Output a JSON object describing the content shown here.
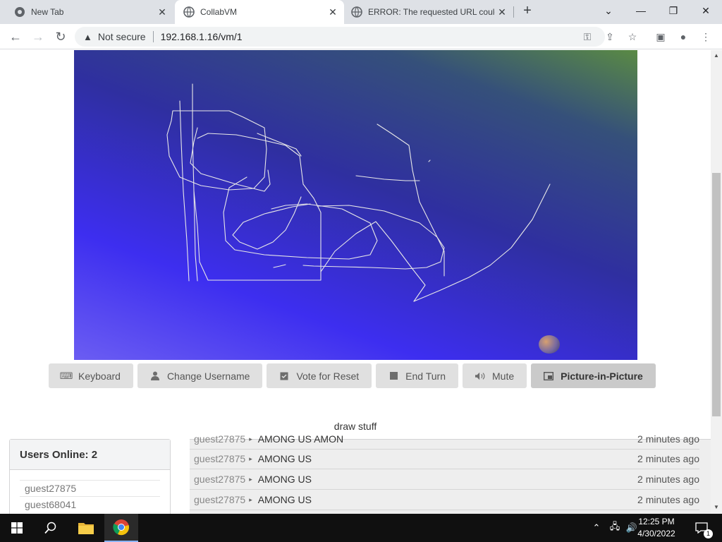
{
  "browser": {
    "tabs": [
      {
        "title": "New Tab",
        "icon": "chrome-icon",
        "active": false
      },
      {
        "title": "CollabVM",
        "icon": "globe-icon",
        "active": true
      },
      {
        "title": "ERROR: The requested URL could",
        "icon": "globe-icon",
        "active": false
      }
    ],
    "security_label": "Not secure",
    "url": "192.168.1.16/vm/1"
  },
  "vm": {
    "buttons": [
      {
        "label": "Keyboard",
        "icon": "keyboard-icon"
      },
      {
        "label": "Change Username",
        "icon": "user-icon"
      },
      {
        "label": "Vote for Reset",
        "icon": "ballot-icon"
      },
      {
        "label": "End Turn",
        "icon": "stop-icon"
      },
      {
        "label": "Mute",
        "icon": "volume-icon"
      },
      {
        "label": "Picture-in-Picture",
        "icon": "pip-icon"
      }
    ],
    "motd": "draw stuff"
  },
  "users": {
    "title": "Users Online: 2",
    "list": [
      "guest27875",
      "guest68041"
    ]
  },
  "chat": {
    "messages": [
      {
        "user": "guest27875",
        "text": "AMONG US AMON",
        "time": "2 minutes ago"
      },
      {
        "user": "guest27875",
        "text": "AMONG US",
        "time": "2 minutes ago"
      },
      {
        "user": "guest27875",
        "text": "AMONG US",
        "time": "2 minutes ago"
      },
      {
        "user": "guest27875",
        "text": "AMONG US",
        "time": "2 minutes ago"
      }
    ]
  },
  "taskbar": {
    "time": "12:25 PM",
    "date": "4/30/2022",
    "notifications": "1"
  }
}
